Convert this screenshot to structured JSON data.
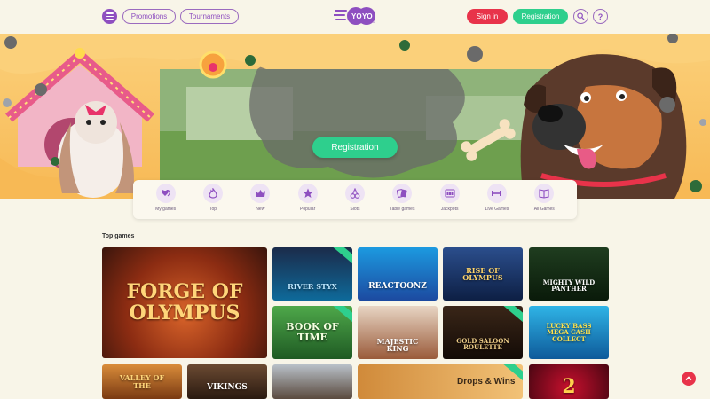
{
  "header": {
    "promotions_label": "Promotions",
    "tournaments_label": "Tournaments",
    "logo_text": "YOYO CASINO",
    "signin_label": "Sign in",
    "registration_label": "Registration",
    "help_label": "?"
  },
  "banner": {
    "cta_label": "Registration"
  },
  "categories": [
    {
      "label": "My games",
      "icon": "hearts-icon"
    },
    {
      "label": "Top",
      "icon": "flame-icon"
    },
    {
      "label": "New",
      "icon": "crown-icon"
    },
    {
      "label": "Popular",
      "icon": "star-icon"
    },
    {
      "label": "Slots",
      "icon": "cherry-icon"
    },
    {
      "label": "Table games",
      "icon": "cards-icon"
    },
    {
      "label": "Jackpots",
      "icon": "slot-reels-icon"
    },
    {
      "label": "Live Games",
      "icon": "dumbbell-icon"
    },
    {
      "label": "All Games",
      "icon": "book-icon"
    }
  ],
  "top_games": {
    "title": "Top games",
    "games": [
      {
        "name": "FORGE OF OLYMPUS"
      },
      {
        "name": "RIVER STYX"
      },
      {
        "name": "REACTOONZ"
      },
      {
        "name": "RISE OF OLYMPUS"
      },
      {
        "name": "MIGHTY WILD PANTHER"
      },
      {
        "name": "BOOK OF TIME"
      },
      {
        "name": "MAJESTIC KING"
      },
      {
        "name": "GOLD SALOON ROULETTE"
      },
      {
        "name": "LUCKY BASS MEGA CASH COLLECT"
      },
      {
        "name": "VALLEY OF THE"
      },
      {
        "name": "VIKINGS"
      },
      {
        "name": ""
      },
      {
        "name": "Drops & Wins"
      },
      {
        "name": "2"
      }
    ]
  },
  "colors": {
    "purple": "#8e4fc0",
    "red": "#e8334a",
    "green": "#2ecf8d",
    "background": "#f8f5e8"
  }
}
